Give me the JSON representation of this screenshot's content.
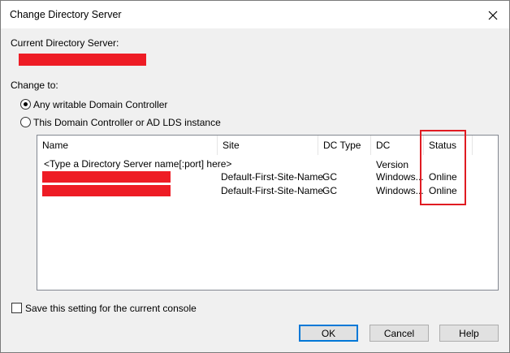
{
  "window": {
    "title": "Change Directory Server"
  },
  "current": {
    "label": "Current Directory Server:"
  },
  "change_to": {
    "label": "Change to:",
    "option_any": "Any writable Domain Controller",
    "option_this": "This Domain Controller or AD LDS instance"
  },
  "table": {
    "columns": [
      "Name",
      "Site",
      "DC Type",
      "DC Version",
      "Status"
    ],
    "placeholder": "<Type a Directory Server name[:port] here>",
    "rows": [
      {
        "site": "Default-First-Site-Name",
        "dc_type": "GC",
        "dc_version": "Windows...",
        "status": "Online"
      },
      {
        "site": "Default-First-Site-Name",
        "dc_type": "GC",
        "dc_version": "Windows...",
        "status": "Online"
      }
    ]
  },
  "save_setting": {
    "label": "Save this setting for the current console"
  },
  "buttons": {
    "ok": "OK",
    "cancel": "Cancel",
    "help": "Help"
  },
  "colors": {
    "redaction": "#ee1c25",
    "highlight": "#e01b22",
    "focus": "#0078d7"
  }
}
